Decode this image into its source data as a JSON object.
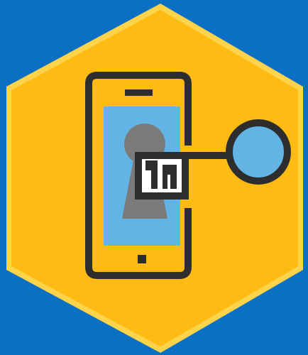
{
  "illustration": {
    "subject": "mobile-security-key",
    "colors": {
      "background": "#0b6fc4",
      "hexagon_fill": "#fdbb13",
      "hexagon_outline": "#ffd34a",
      "outline_dark": "#2d2d2d",
      "screen": "#63b3e4",
      "keyhole": "#7a7a7a",
      "key_head": "#63b3e4",
      "key_bit": "#ffffff"
    },
    "icons": [
      "hexagon-badge",
      "smartphone-icon",
      "keyhole-icon",
      "key-icon"
    ]
  }
}
